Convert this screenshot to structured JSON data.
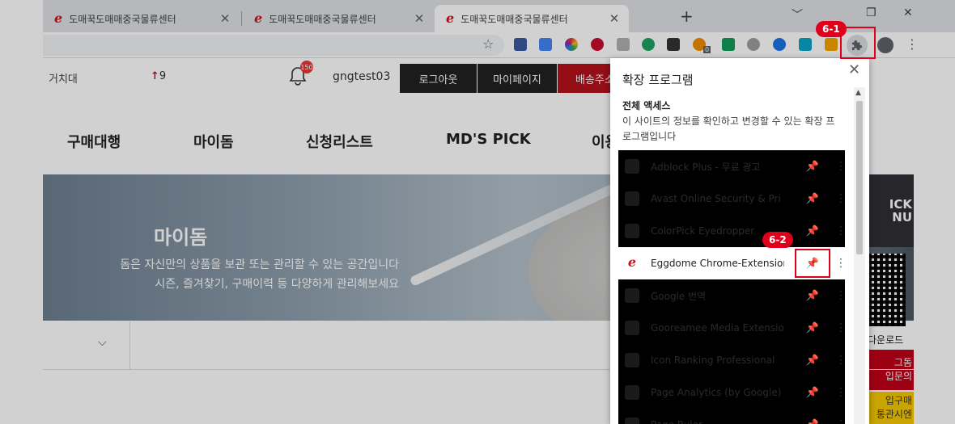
{
  "browser": {
    "tabs": [
      {
        "title": "도매꾹도매매중국물류센터",
        "close": "✕"
      },
      {
        "title": "도매꾹도매매중국물류센터",
        "close": "✕"
      },
      {
        "title": "도매꾹도매매중국물류센터",
        "close": "✕"
      }
    ],
    "new_tab": "+",
    "window": {
      "minimize": "﹀",
      "restore": "❐",
      "close": "✕"
    },
    "star": "☆",
    "ext_badge_count": "0"
  },
  "site": {
    "sale_label": "거치대",
    "rank_arrow": "↑",
    "rank_value": "9",
    "bell_badge": "150",
    "username": "gngtest03",
    "buttons": {
      "logout": "로그아웃",
      "mypage": "마이페이지",
      "shipping": "배송주소"
    },
    "nav": [
      "구매대행",
      "마이돔",
      "신청리스트",
      "MD'S PICK",
      "이용"
    ],
    "hero_title": "마이돔",
    "hero_desc_1": "돔은 자신만의 상품을 보관 또는 관리할 수 있는 공간입니다",
    "hero_desc_2": "시즌, 즐겨찾기, 구매이력 등 다양하게 관리해보세요",
    "side_pick_1": "ICK",
    "side_pick_2": "NU",
    "qr_label": "다운로드",
    "side_red_1": "그돔",
    "side_red_2": "입문의",
    "side_yellow_1": "입구매",
    "side_yellow_2": "통관시엔"
  },
  "popup": {
    "title": "확장 프로그램",
    "access_head": "전체 액세스",
    "access_desc": "이 사이트의 정보를 확인하고 변경할 수 있는 확장 프로그램입니다",
    "extensions": [
      {
        "name": "Adblock Plus - 무료 광고",
        "color": "#c70d2c",
        "dim": true
      },
      {
        "name": "Avast Online Security & Pri",
        "color": "#ff7800",
        "dim": true
      },
      {
        "name": "ColorPick Eyedropper",
        "color": "#7b3fa0",
        "dim": true
      },
      {
        "name": "Eggdome Chrome-Extension",
        "color": "#d0121a",
        "dim": false
      },
      {
        "name": "Google 번역",
        "color": "#4285f4",
        "dim": true
      },
      {
        "name": "Gooreamee Media Extension",
        "color": "#1a73e8",
        "dim": true
      },
      {
        "name": "Icon Ranking Professional",
        "color": "#555555",
        "dim": true
      },
      {
        "name": "Page Analytics (by Google)",
        "color": "#f29900",
        "dim": true
      },
      {
        "name": "Page Ruler",
        "color": "#888888",
        "dim": true
      }
    ],
    "pin": "📌",
    "more": "⋮",
    "close": "✕"
  },
  "callouts": {
    "step1": "6-1",
    "step2": "6-2"
  }
}
